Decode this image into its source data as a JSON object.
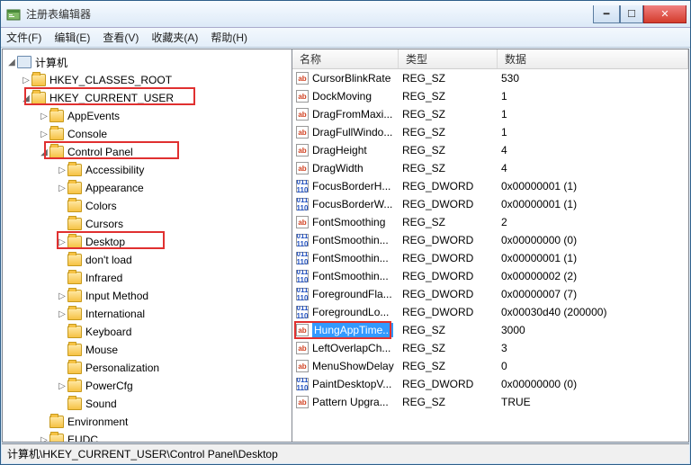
{
  "window": {
    "title": "注册表编辑器"
  },
  "menu": {
    "file": "文件(F)",
    "edit": "编辑(E)",
    "view": "查看(V)",
    "fav": "收藏夹(A)",
    "help": "帮助(H)"
  },
  "cols": {
    "name": "名称",
    "type": "类型",
    "data": "数据"
  },
  "tree": {
    "root": "计算机",
    "hkcr": "HKEY_CLASSES_ROOT",
    "hkcu": "HKEY_CURRENT_USER",
    "appevents": "AppEvents",
    "console": "Console",
    "cpanel": "Control Panel",
    "access": "Accessibility",
    "appear": "Appearance",
    "colors": "Colors",
    "cursors": "Cursors",
    "desktop": "Desktop",
    "dontload": "don't load",
    "infrared": "Infrared",
    "inputm": "Input Method",
    "intl": "International",
    "keyboard": "Keyboard",
    "mouse": "Mouse",
    "personal": "Personalization",
    "powercfg": "PowerCfg",
    "sound": "Sound",
    "env": "Environment",
    "eudc": "EUDC"
  },
  "values": [
    {
      "n": "CursorBlinkRate",
      "t": "REG_SZ",
      "d": "530",
      "k": "sz"
    },
    {
      "n": "DockMoving",
      "t": "REG_SZ",
      "d": "1",
      "k": "sz"
    },
    {
      "n": "DragFromMaxi...",
      "t": "REG_SZ",
      "d": "1",
      "k": "sz"
    },
    {
      "n": "DragFullWindo...",
      "t": "REG_SZ",
      "d": "1",
      "k": "sz"
    },
    {
      "n": "DragHeight",
      "t": "REG_SZ",
      "d": "4",
      "k": "sz"
    },
    {
      "n": "DragWidth",
      "t": "REG_SZ",
      "d": "4",
      "k": "sz"
    },
    {
      "n": "FocusBorderH...",
      "t": "REG_DWORD",
      "d": "0x00000001 (1)",
      "k": "dw"
    },
    {
      "n": "FocusBorderW...",
      "t": "REG_DWORD",
      "d": "0x00000001 (1)",
      "k": "dw"
    },
    {
      "n": "FontSmoothing",
      "t": "REG_SZ",
      "d": "2",
      "k": "sz"
    },
    {
      "n": "FontSmoothin...",
      "t": "REG_DWORD",
      "d": "0x00000000 (0)",
      "k": "dw"
    },
    {
      "n": "FontSmoothin...",
      "t": "REG_DWORD",
      "d": "0x00000001 (1)",
      "k": "dw"
    },
    {
      "n": "FontSmoothin...",
      "t": "REG_DWORD",
      "d": "0x00000002 (2)",
      "k": "dw"
    },
    {
      "n": "ForegroundFla...",
      "t": "REG_DWORD",
      "d": "0x00000007 (7)",
      "k": "dw"
    },
    {
      "n": "ForegroundLo...",
      "t": "REG_DWORD",
      "d": "0x00030d40 (200000)",
      "k": "dw"
    },
    {
      "n": "HungAppTime...",
      "t": "REG_SZ",
      "d": "3000",
      "k": "sz",
      "sel": true
    },
    {
      "n": "LeftOverlapCh...",
      "t": "REG_SZ",
      "d": "3",
      "k": "sz"
    },
    {
      "n": "MenuShowDelay",
      "t": "REG_SZ",
      "d": "0",
      "k": "sz"
    },
    {
      "n": "PaintDesktopV...",
      "t": "REG_DWORD",
      "d": "0x00000000 (0)",
      "k": "dw"
    },
    {
      "n": "Pattern Upgra...",
      "t": "REG_SZ",
      "d": "TRUE",
      "k": "sz"
    }
  ],
  "status": "计算机\\HKEY_CURRENT_USER\\Control Panel\\Desktop"
}
